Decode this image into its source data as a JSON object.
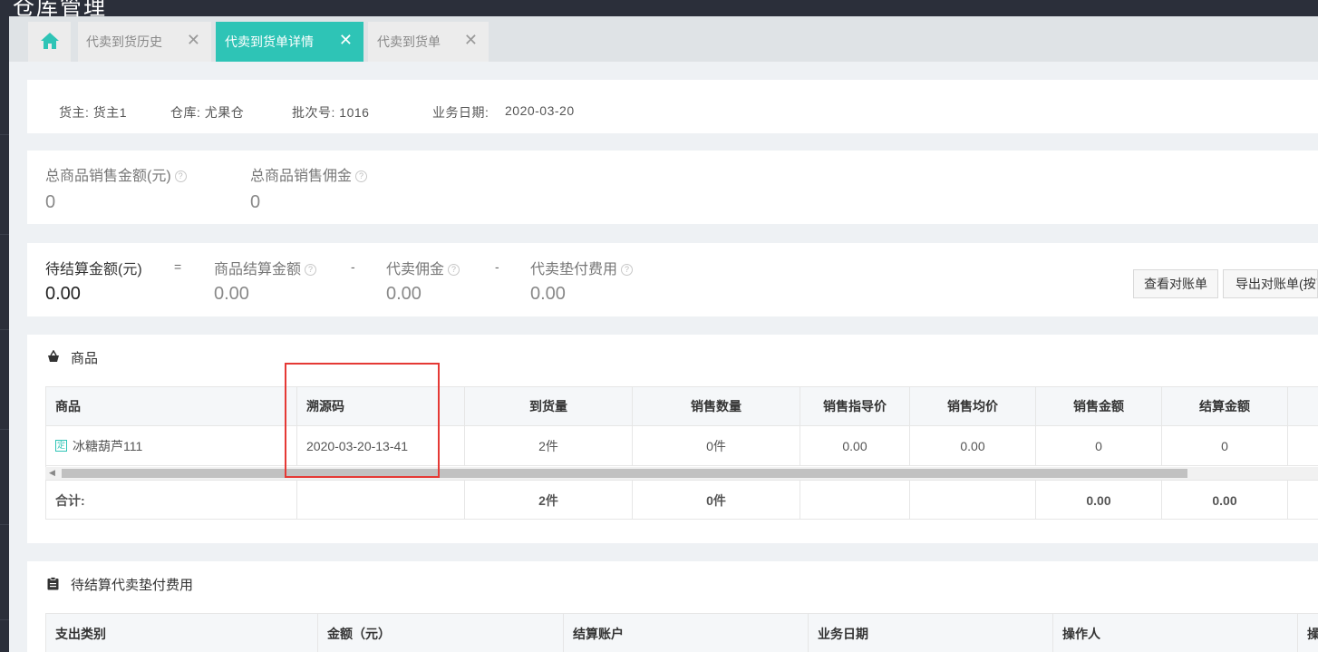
{
  "window": {
    "title": "仓库管理"
  },
  "tabs": [
    {
      "name": "home",
      "icon": "home-icon"
    },
    {
      "label": "代卖到货历史",
      "close": "✕"
    },
    {
      "label": "代卖到货单详情",
      "close": "✕",
      "active": true
    },
    {
      "label": "代卖到货单",
      "close": "✕"
    }
  ],
  "info": {
    "owner": "货主: 货主1",
    "warehouse": "仓库: 尤果仓",
    "batch": "批次号: 1016",
    "date_label": "业务日期:",
    "date_value": "2020-03-20"
  },
  "summary": {
    "total_sales_label": "总商品销售金额(元)",
    "total_sales_value": "0",
    "total_commission_label": "总商品销售佣金",
    "total_commission_value": "0"
  },
  "settlement": {
    "pending_label": "待结算金额(元)",
    "pending_value": "0.00",
    "eq": "=",
    "goods_label": "商品结算金额",
    "goods_value": "0.00",
    "minus1": "-",
    "commission_label": "代卖佣金",
    "commission_value": "0.00",
    "minus2": "-",
    "advance_label": "代卖垫付费用",
    "advance_value": "0.00",
    "view_statement_button": "查看对账单",
    "export_statement_button": "导出对账单(按商品)"
  },
  "goods_section": {
    "title": "商品",
    "columns": [
      "商品",
      "溯源码",
      "到货量",
      "销售数量",
      "销售指导价",
      "销售均价",
      "销售金额",
      "结算金额"
    ],
    "rows": [
      {
        "tag": "定",
        "name": "冰糖葫芦111",
        "trace": "2020-03-20-13-41",
        "arrival": "2件",
        "sold": "0件",
        "guide_price": "0.00",
        "avg_price": "0.00",
        "sales_amount": "0",
        "settle_amount": "0"
      }
    ],
    "total": {
      "label": "合计:",
      "arrival": "2件",
      "sold": "0件",
      "sales_amount": "0.00",
      "settle_amount": "0.00"
    }
  },
  "expense_section": {
    "title": "待结算代卖垫付费用",
    "columns": [
      "支出类别",
      "金额（元）",
      "结算账户",
      "业务日期",
      "操作人",
      "操"
    ]
  },
  "colors": {
    "accent": "#2ec4b6",
    "highlight_box": "#e53935",
    "sidebar": "#2b2f3a"
  }
}
